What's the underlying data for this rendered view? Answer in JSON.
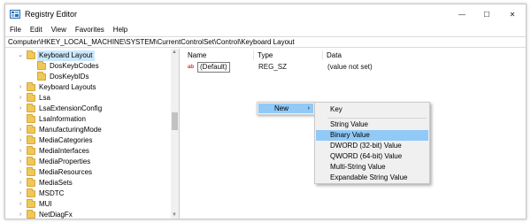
{
  "window": {
    "title": "Registry Editor"
  },
  "window_controls": {
    "minimize": "—",
    "maximize": "☐",
    "close": "✕"
  },
  "menubar": [
    "File",
    "Edit",
    "View",
    "Favorites",
    "Help"
  ],
  "address": "Computer\\HKEY_LOCAL_MACHINE\\SYSTEM\\CurrentControlSet\\Control\\Keyboard Layout",
  "tree": [
    {
      "label": "Keyboard Layout",
      "expanded": true,
      "selected": true
    },
    {
      "label": "DosKeybCodes"
    },
    {
      "label": "DosKeybIDs"
    },
    {
      "label": "Keyboard Layouts"
    },
    {
      "label": "Lsa"
    },
    {
      "label": "LsaExtensionConfig"
    },
    {
      "label": "LsaInformation"
    },
    {
      "label": "ManufacturingMode"
    },
    {
      "label": "MediaCategories"
    },
    {
      "label": "MediaInterfaces"
    },
    {
      "label": "MediaProperties"
    },
    {
      "label": "MediaResources"
    },
    {
      "label": "MediaSets"
    },
    {
      "label": "MSDTC"
    },
    {
      "label": "MUI"
    },
    {
      "label": "NetDiagFx"
    }
  ],
  "columns": {
    "name": "Name",
    "type": "Type",
    "data": "Data"
  },
  "values": [
    {
      "name": "(Default)",
      "icon": "ab",
      "type": "REG_SZ",
      "data": "(value not set)"
    }
  ],
  "context_menu": {
    "new_label": "New",
    "arrow": "›"
  },
  "new_submenu": {
    "key": "Key",
    "items": [
      {
        "label": "String Value"
      },
      {
        "label": "Binary Value",
        "highlighted": true
      },
      {
        "label": "DWORD (32-bit) Value"
      },
      {
        "label": "QWORD (64-bit) Value"
      },
      {
        "label": "Multi-String Value"
      },
      {
        "label": "Expandable String Value"
      }
    ]
  },
  "colors": {
    "selection": "#cce8ff",
    "menu_highlight": "#91c9f7",
    "folder": "#f0c85a"
  }
}
